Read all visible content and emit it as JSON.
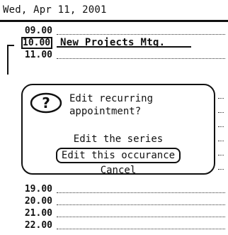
{
  "header": {
    "date": "Wed, Apr 11, 2001"
  },
  "slots": [
    {
      "time": "09.00",
      "appointment": ""
    },
    {
      "time": "10.00",
      "appointment": "New Projects Mtg."
    },
    {
      "time": "11.00",
      "appointment": ""
    },
    {
      "time": "19.00",
      "appointment": ""
    },
    {
      "time": "20.00",
      "appointment": ""
    },
    {
      "time": "21.00",
      "appointment": ""
    },
    {
      "time": "22.00",
      "appointment": ""
    }
  ],
  "dialog": {
    "message": "Edit recurring appointment?",
    "icon": "question-icon",
    "options": {
      "edit_series": "Edit the series",
      "edit_occurrence": "Edit this occurance",
      "cancel": "Cancel"
    }
  }
}
